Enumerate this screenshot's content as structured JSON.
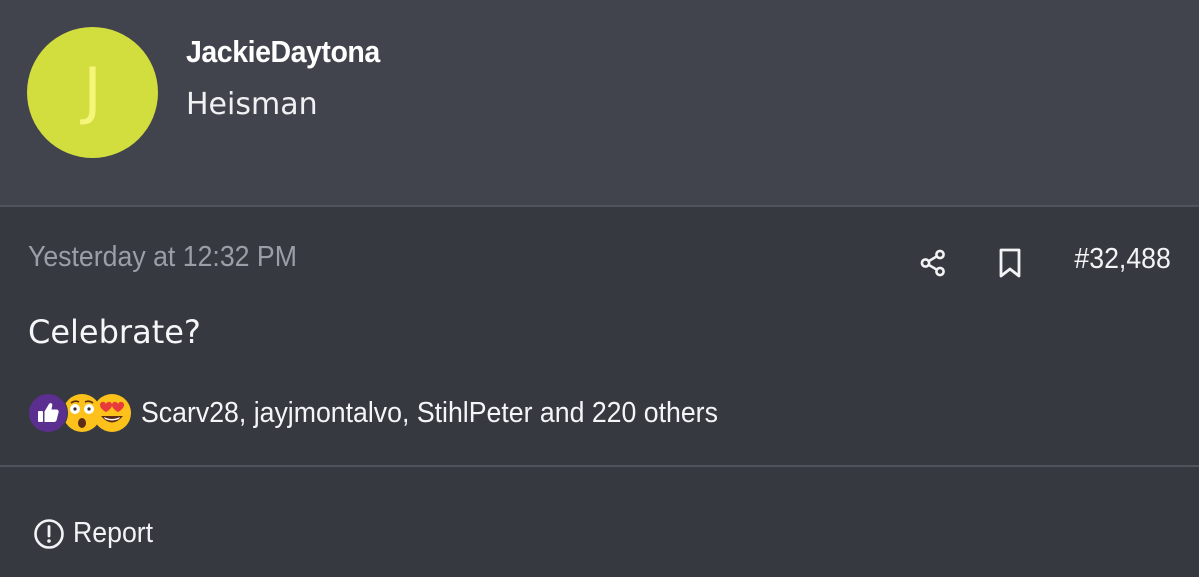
{
  "post": {
    "author": {
      "initial": "J",
      "username": "JackieDaytona",
      "title": "Heisman"
    },
    "timestamp": "Yesterday at 12:32 PM",
    "post_number": "#32,488",
    "body": "Celebrate?",
    "reactions": {
      "icons": [
        "thumbs-up-icon",
        "shocked-face-icon",
        "heart-eyes-icon"
      ],
      "summary": "Scarv28, jayjmontalvo, StihlPeter and 220 others"
    },
    "actions": {
      "share_icon": "share-icon",
      "bookmark_icon": "bookmark-icon",
      "report_label": "Report"
    }
  },
  "colors": {
    "avatar": "#d2dd3e",
    "header_bg": "#41444c",
    "body_bg": "#363940",
    "like_purple": "#5b2f8f"
  }
}
